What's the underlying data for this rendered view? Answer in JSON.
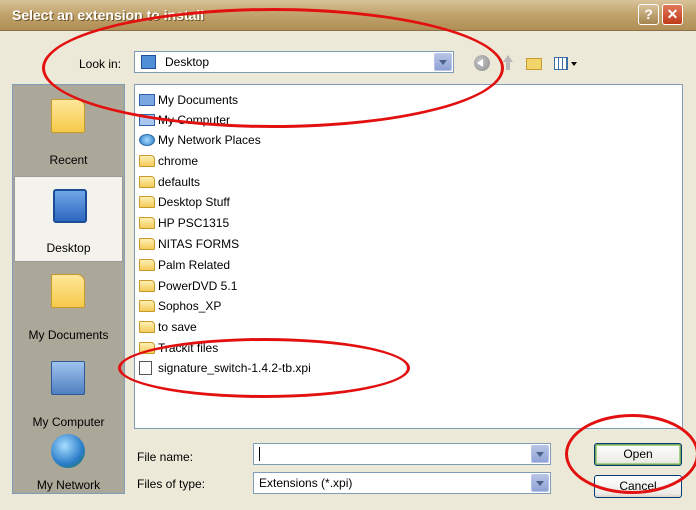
{
  "window": {
    "title": "Select an extension to install"
  },
  "lookin": {
    "label": "Look in:",
    "value": "Desktop"
  },
  "places": [
    {
      "label": "Recent"
    },
    {
      "label": "Desktop"
    },
    {
      "label": "My Documents"
    },
    {
      "label": "My Computer"
    },
    {
      "label": "My Network"
    }
  ],
  "files": [
    {
      "name": "My Documents",
      "icon": "my-documents-icon"
    },
    {
      "name": "My Computer",
      "icon": "my-computer-icon"
    },
    {
      "name": "My Network Places",
      "icon": "network-places-icon"
    },
    {
      "name": "chrome",
      "icon": "folder-icon"
    },
    {
      "name": "defaults",
      "icon": "folder-icon"
    },
    {
      "name": "Desktop Stuff",
      "icon": "folder-icon"
    },
    {
      "name": "HP PSC1315",
      "icon": "folder-icon"
    },
    {
      "name": "NITAS FORMS",
      "icon": "folder-icon"
    },
    {
      "name": "Palm Related",
      "icon": "folder-icon"
    },
    {
      "name": "PowerDVD 5.1",
      "icon": "folder-icon"
    },
    {
      "name": "Sophos_XP",
      "icon": "folder-icon"
    },
    {
      "name": "to save",
      "icon": "folder-icon"
    },
    {
      "name": "Trackit files",
      "icon": "folder-icon"
    },
    {
      "name": "signature_switch-1.4.2-tb.xpi",
      "icon": "xpi-file-icon"
    }
  ],
  "filename": {
    "label": "File name:",
    "value": ""
  },
  "filetype": {
    "label": "Files of type:",
    "value": "Extensions (*.xpi)"
  },
  "buttons": {
    "open": "Open",
    "cancel": "Cancel"
  },
  "colors": {
    "annotation": "#e31010",
    "titlebar": "#c2a46e",
    "dialog_bg": "#ece9d8"
  }
}
